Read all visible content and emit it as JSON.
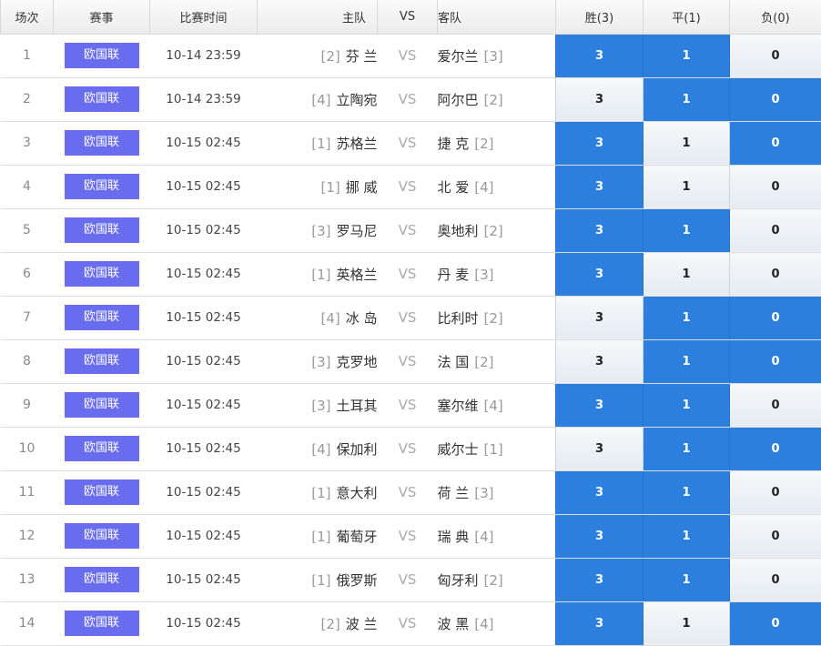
{
  "headers": {
    "no": "场次",
    "league": "赛事",
    "time": "比赛时间",
    "home": "主队",
    "vs": "VS",
    "away": "客队",
    "win": "胜(3)",
    "draw": "平(1)",
    "loss": "负(0)"
  },
  "option_values": {
    "win": "3",
    "draw": "1",
    "loss": "0"
  },
  "colors": {
    "selected": "#2d7fde",
    "badge": "#6a6cf0"
  },
  "rows": [
    {
      "no": "1",
      "league": "欧国联",
      "time": "10-14 23:59",
      "home_rank": "[2]",
      "home": "芬 兰",
      "vs": "VS",
      "away": "爱尔兰",
      "away_rank": "[3]",
      "win_selected": true,
      "draw_selected": true,
      "loss_selected": false
    },
    {
      "no": "2",
      "league": "欧国联",
      "time": "10-14 23:59",
      "home_rank": "[4]",
      "home": "立陶宛",
      "vs": "VS",
      "away": "阿尔巴",
      "away_rank": "[2]",
      "win_selected": false,
      "draw_selected": true,
      "loss_selected": true
    },
    {
      "no": "3",
      "league": "欧国联",
      "time": "10-15 02:45",
      "home_rank": "[1]",
      "home": "苏格兰",
      "vs": "VS",
      "away": "捷 克",
      "away_rank": "[2]",
      "win_selected": true,
      "draw_selected": false,
      "loss_selected": true
    },
    {
      "no": "4",
      "league": "欧国联",
      "time": "10-15 02:45",
      "home_rank": "[1]",
      "home": "挪 威",
      "vs": "VS",
      "away": "北 爱",
      "away_rank": "[4]",
      "win_selected": true,
      "draw_selected": false,
      "loss_selected": false
    },
    {
      "no": "5",
      "league": "欧国联",
      "time": "10-15 02:45",
      "home_rank": "[3]",
      "home": "罗马尼",
      "vs": "VS",
      "away": "奥地利",
      "away_rank": "[2]",
      "win_selected": true,
      "draw_selected": true,
      "loss_selected": false
    },
    {
      "no": "6",
      "league": "欧国联",
      "time": "10-15 02:45",
      "home_rank": "[1]",
      "home": "英格兰",
      "vs": "VS",
      "away": "丹 麦",
      "away_rank": "[3]",
      "win_selected": true,
      "draw_selected": false,
      "loss_selected": false
    },
    {
      "no": "7",
      "league": "欧国联",
      "time": "10-15 02:45",
      "home_rank": "[4]",
      "home": "冰 岛",
      "vs": "VS",
      "away": "比利时",
      "away_rank": "[2]",
      "win_selected": false,
      "draw_selected": true,
      "loss_selected": true
    },
    {
      "no": "8",
      "league": "欧国联",
      "time": "10-15 02:45",
      "home_rank": "[3]",
      "home": "克罗地",
      "vs": "VS",
      "away": "法 国",
      "away_rank": "[2]",
      "win_selected": false,
      "draw_selected": true,
      "loss_selected": true
    },
    {
      "no": "9",
      "league": "欧国联",
      "time": "10-15 02:45",
      "home_rank": "[3]",
      "home": "土耳其",
      "vs": "VS",
      "away": "塞尔维",
      "away_rank": "[4]",
      "win_selected": true,
      "draw_selected": true,
      "loss_selected": false
    },
    {
      "no": "10",
      "league": "欧国联",
      "time": "10-15 02:45",
      "home_rank": "[4]",
      "home": "保加利",
      "vs": "VS",
      "away": "威尔士",
      "away_rank": "[1]",
      "win_selected": false,
      "draw_selected": true,
      "loss_selected": true
    },
    {
      "no": "11",
      "league": "欧国联",
      "time": "10-15 02:45",
      "home_rank": "[1]",
      "home": "意大利",
      "vs": "VS",
      "away": "荷 兰",
      "away_rank": "[3]",
      "win_selected": true,
      "draw_selected": true,
      "loss_selected": false
    },
    {
      "no": "12",
      "league": "欧国联",
      "time": "10-15 02:45",
      "home_rank": "[1]",
      "home": "葡萄牙",
      "vs": "VS",
      "away": "瑞 典",
      "away_rank": "[4]",
      "win_selected": true,
      "draw_selected": true,
      "loss_selected": false
    },
    {
      "no": "13",
      "league": "欧国联",
      "time": "10-15 02:45",
      "home_rank": "[1]",
      "home": "俄罗斯",
      "vs": "VS",
      "away": "匈牙利",
      "away_rank": "[2]",
      "win_selected": true,
      "draw_selected": true,
      "loss_selected": false
    },
    {
      "no": "14",
      "league": "欧国联",
      "time": "10-15 02:45",
      "home_rank": "[2]",
      "home": "波 兰",
      "vs": "VS",
      "away": "波 黑",
      "away_rank": "[4]",
      "win_selected": true,
      "draw_selected": false,
      "loss_selected": true
    }
  ]
}
